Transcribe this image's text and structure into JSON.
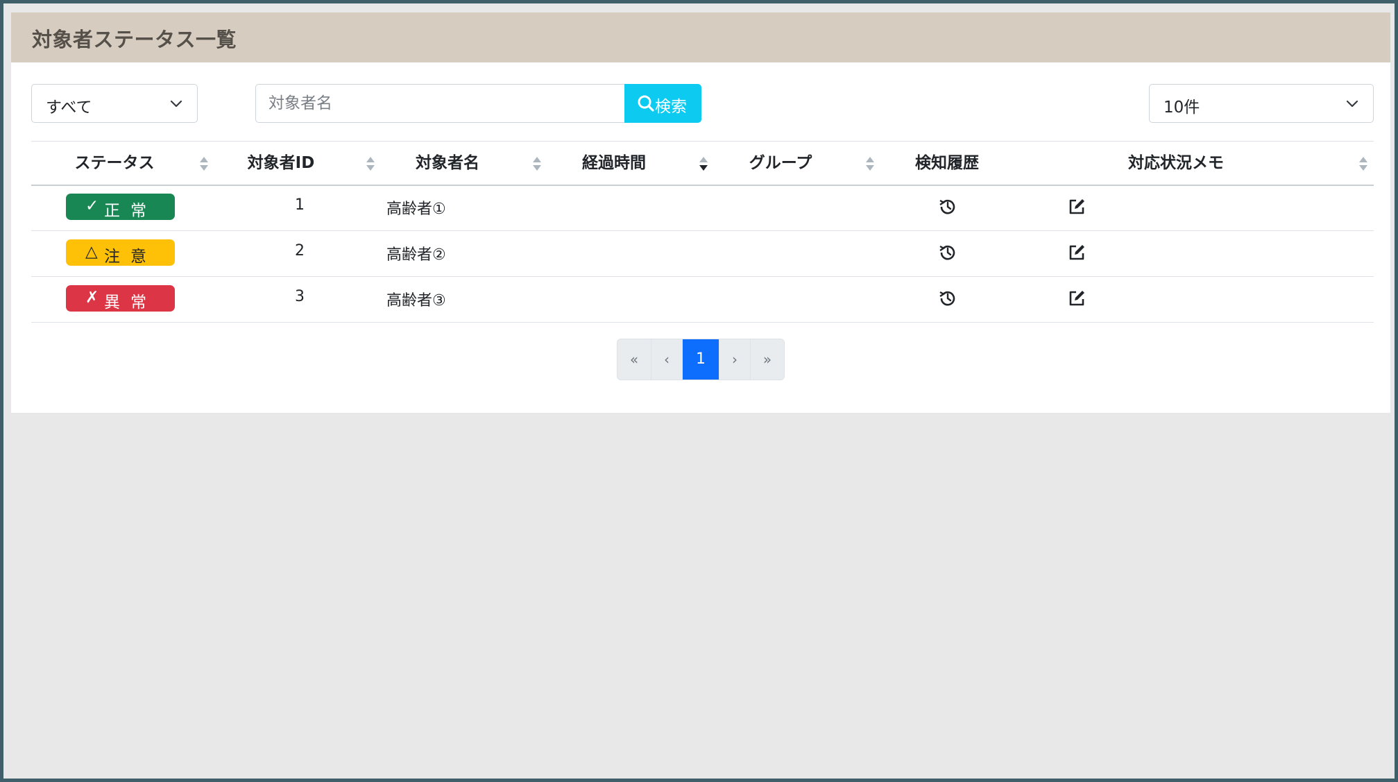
{
  "panel": {
    "title": "対象者ステータス一覧"
  },
  "filter": {
    "status_selected": "すべて",
    "page_size_selected": "10件"
  },
  "search": {
    "placeholder": "対象者名",
    "button_label": "検索"
  },
  "table": {
    "headers": [
      "ステータス",
      "対象者ID",
      "対象者名",
      "経過時間",
      "グループ",
      "検知履歴",
      "対応状況メモ"
    ],
    "rows": [
      {
        "status_symbol": "✓",
        "status_label": "正常",
        "status_color": "#198754",
        "id": "1",
        "name": "高齢者①",
        "elapsed": "",
        "group": "",
        "memo": ""
      },
      {
        "status_symbol": "△",
        "status_label": "注意",
        "status_color": "#ffc107",
        "id": "2",
        "name": "高齢者②",
        "elapsed": "",
        "group": "",
        "memo": ""
      },
      {
        "status_symbol": "✗",
        "status_label": "異常",
        "status_color": "#dc3545",
        "id": "3",
        "name": "高齢者③",
        "elapsed": "",
        "group": "",
        "memo": ""
      }
    ]
  },
  "pagination": {
    "first": "«",
    "prev": "‹",
    "current": "1",
    "next": "›",
    "last": "»"
  },
  "colors": {
    "header_bg": "#d6cdc0",
    "search_button": "#0dcaf0",
    "active_page": "#0d6efd",
    "frame_border": "#3f5f6b"
  }
}
